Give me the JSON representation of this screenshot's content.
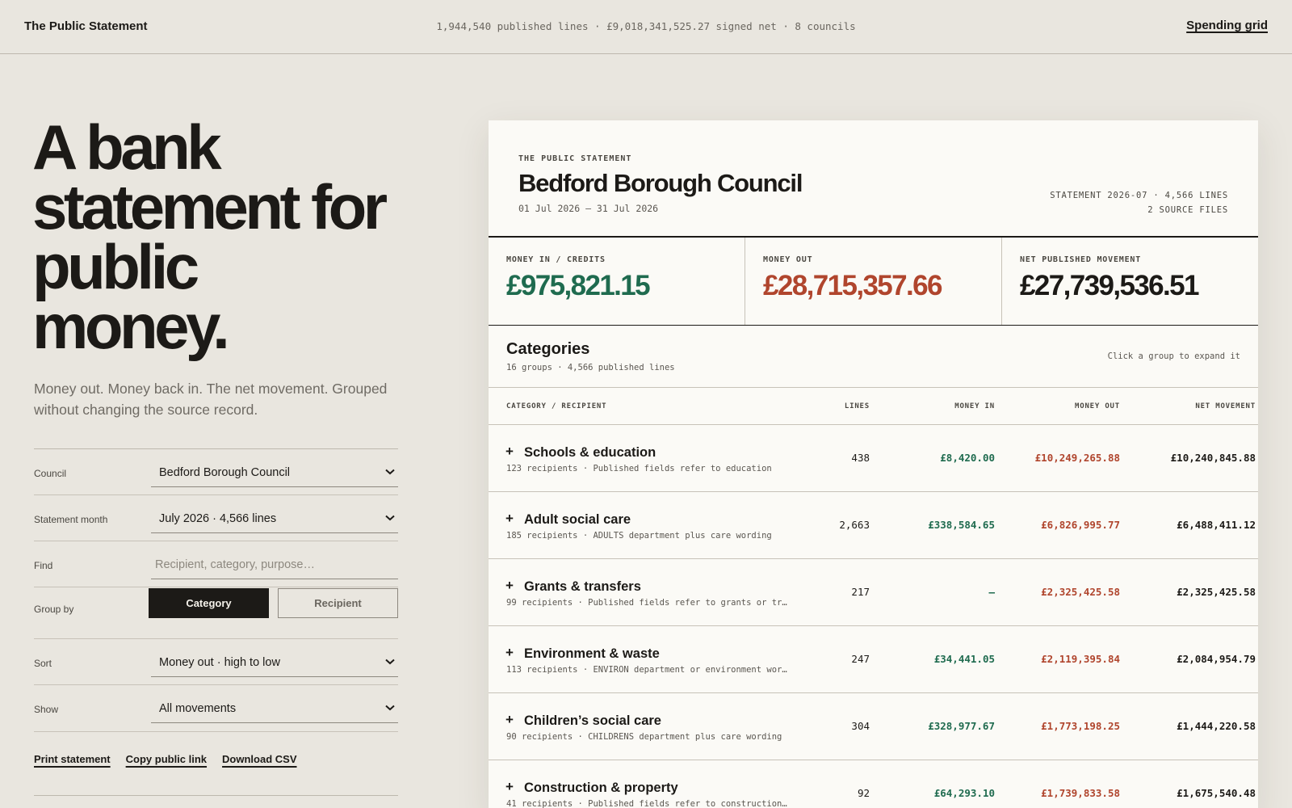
{
  "topbar": {
    "brand": "The Public Statement",
    "summary": "1,944,540 published lines · £9,018,341,525.27 signed net · 8 councils",
    "nav_link": "Spending grid"
  },
  "hero": {
    "headline": "A bank statement for public money.",
    "lede": "Money out. Money back in. The net movement. Grouped without changing the source record."
  },
  "controls": {
    "council": {
      "label": "Council",
      "value": "Bedford Borough Council"
    },
    "month": {
      "label": "Statement month",
      "value": "July 2026 · 4,566 lines"
    },
    "find": {
      "label": "Find",
      "placeholder": "Recipient, category, purpose…"
    },
    "group_by": {
      "label": "Group by",
      "options": [
        "Category",
        "Recipient"
      ],
      "selected": "Category"
    },
    "sort": {
      "label": "Sort",
      "value": "Money out · high to low"
    },
    "show": {
      "label": "Show",
      "value": "All movements"
    },
    "actions": [
      "Print statement",
      "Copy public link",
      "Download CSV"
    ]
  },
  "statement": {
    "eyebrow": "THE PUBLIC STATEMENT",
    "council": "Bedford Borough Council",
    "period": "01 Jul 2026 – 31 Jul 2026",
    "meta_line1": "STATEMENT 2026-07 · 4,566 LINES",
    "meta_line2": "2 SOURCE FILES",
    "totals": [
      {
        "label": "MONEY IN / CREDITS",
        "value": "£975,821.15",
        "tone": "green"
      },
      {
        "label": "MONEY OUT",
        "value": "£28,715,357.66",
        "tone": "red"
      },
      {
        "label": "NET PUBLISHED MOVEMENT",
        "value": "£27,739,536.51",
        "tone": "ink"
      }
    ],
    "categories_title": "Categories",
    "categories_sub": "16 groups · 4,566 published lines",
    "categories_hint": "Click a group to expand it",
    "columns": [
      "CATEGORY / RECIPIENT",
      "LINES",
      "MONEY IN",
      "MONEY OUT",
      "NET MOVEMENT"
    ],
    "rows": [
      {
        "expand": "+",
        "name": "Schools & education",
        "desc": "123 recipients · Published fields refer to education",
        "lines": "438",
        "money_in": "£8,420.00",
        "money_out": "£10,249,265.88",
        "net": "£10,240,845.88"
      },
      {
        "expand": "+",
        "name": "Adult social care",
        "desc": "185 recipients · ADULTS department plus care wording",
        "lines": "2,663",
        "money_in": "£338,584.65",
        "money_out": "£6,826,995.77",
        "net": "£6,488,411.12"
      },
      {
        "expand": "+",
        "name": "Grants & transfers",
        "desc": "99 recipients · Published fields refer to grants or trans…",
        "lines": "217",
        "money_in": "–",
        "money_out": "£2,325,425.58",
        "net": "£2,325,425.58"
      },
      {
        "expand": "+",
        "name": "Environment & waste",
        "desc": "113 recipients · ENVIRON department or environment wording",
        "lines": "247",
        "money_in": "£34,441.05",
        "money_out": "£2,119,395.84",
        "net": "£2,084,954.79"
      },
      {
        "expand": "+",
        "name": "Children’s social care",
        "desc": "90 recipients · CHILDRENS department plus care wording",
        "lines": "304",
        "money_in": "£328,977.67",
        "money_out": "£1,773,198.25",
        "net": "£1,444,220.58"
      },
      {
        "expand": "+",
        "name": "Construction & property",
        "desc": "41 recipients · Published fields refer to construction or…",
        "lines": "92",
        "money_in": "£64,293.10",
        "money_out": "£1,739,833.58",
        "net": "£1,675,540.48"
      }
    ]
  },
  "colors": {
    "background": "#e9e6df",
    "card": "#fbfaf6",
    "ink": "#1c1a17",
    "money_in": "#1f6b4f",
    "money_out": "#b0452d"
  },
  "icons": {
    "select_chevron": "chevron-down-icon",
    "expand": "plus-icon"
  }
}
